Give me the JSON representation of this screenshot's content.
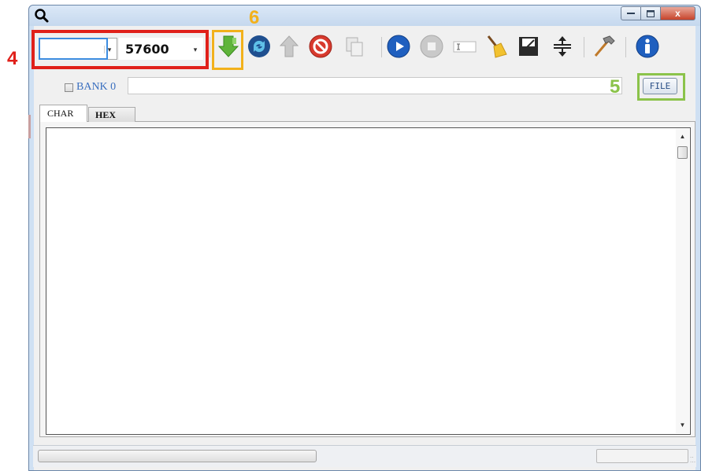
{
  "annotations": [
    {
      "number": "4",
      "color": "#e0201a"
    },
    {
      "number": "6",
      "color": "#f2b11c"
    },
    {
      "number": "5",
      "color": "#8bc34a"
    }
  ],
  "window": {
    "caption_buttons": [
      "minimize",
      "maximize",
      "close"
    ],
    "close_glyph": "x"
  },
  "toolbar": {
    "port_combo": {
      "value": ""
    },
    "baud_combo": {
      "value": "57600"
    },
    "icons": [
      "download-arrow-icon",
      "refresh-icon",
      "upload-arrow-icon",
      "stop-sign-icon",
      "copy-icon",
      "play-icon",
      "stop-icon",
      "text-field-icon",
      "broom-icon",
      "save-disk-icon",
      "resize-vertical-icon",
      "hammer-icon",
      "info-icon"
    ]
  },
  "bank": {
    "label": "BANK 0",
    "checked": false
  },
  "path_field": {
    "value": ""
  },
  "file_button": {
    "label": "FILE"
  },
  "tabs": [
    {
      "label": "CHAR",
      "active": true
    },
    {
      "label": "HEX",
      "active": false
    }
  ],
  "status": {
    "text": ""
  },
  "colors": {
    "window_frame": "#cfe0f3",
    "blue_accent": "#1f5fbf",
    "green_arrow": "#5fb43a",
    "stop_red": "#d83a2e"
  }
}
